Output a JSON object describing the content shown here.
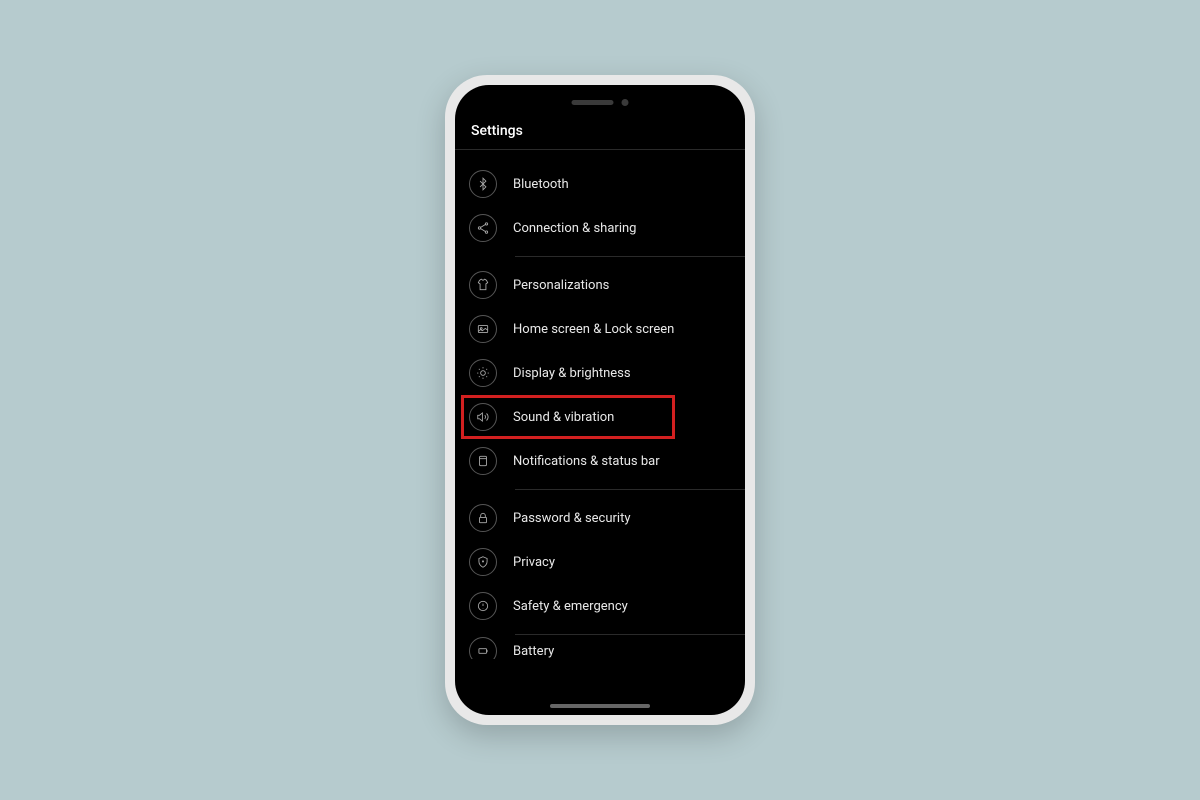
{
  "header": {
    "title": "Settings"
  },
  "groups": [
    {
      "items": [
        {
          "icon": "bluetooth",
          "label": "Bluetooth"
        },
        {
          "icon": "share",
          "label": "Connection & sharing"
        }
      ]
    },
    {
      "items": [
        {
          "icon": "tshirt",
          "label": "Personalizations"
        },
        {
          "icon": "gallery",
          "label": "Home screen & Lock screen"
        },
        {
          "icon": "sun",
          "label": "Display & brightness"
        },
        {
          "icon": "sound",
          "label": "Sound & vibration",
          "highlighted": true
        },
        {
          "icon": "bell",
          "label": "Notifications & status bar"
        }
      ]
    },
    {
      "items": [
        {
          "icon": "lock",
          "label": "Password & security"
        },
        {
          "icon": "shield",
          "label": "Privacy"
        },
        {
          "icon": "alert",
          "label": "Safety & emergency"
        }
      ]
    },
    {
      "items": [
        {
          "icon": "battery",
          "label": "Battery"
        }
      ]
    }
  ],
  "highlight_color": "#d32020"
}
